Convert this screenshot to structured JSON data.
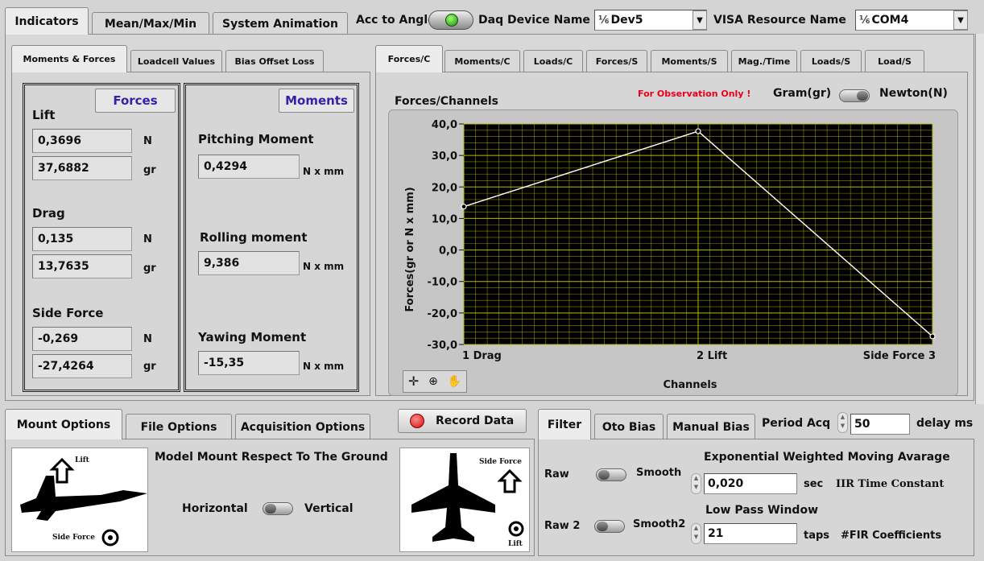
{
  "top_tabs": [
    "Indicators",
    "Mean/Max/Min",
    "System Animation"
  ],
  "header": {
    "acc_label": "Acc to Angle",
    "daq_label": "Daq Device Name",
    "daq_value": "Dev5",
    "visa_label": "VISA Resource Name",
    "visa_value": "COM4",
    "ring_glyph": "⅙"
  },
  "left_tabs": [
    "Moments & Forces",
    "Loadcell Values",
    "Bias Offset Loss"
  ],
  "forces": {
    "button": "Forces",
    "groups": [
      {
        "name": "Lift",
        "n_value": "0,3696",
        "gr_value": "37,6882"
      },
      {
        "name": "Drag",
        "n_value": "0,135",
        "gr_value": "13,7635"
      },
      {
        "name": "Side Force",
        "n_value": "-0,269",
        "gr_value": "-27,4264"
      }
    ],
    "unit_n": "N",
    "unit_gr": "gr"
  },
  "moments": {
    "button": "Moments",
    "items": [
      {
        "name": "Pitching Moment",
        "value": "0,4294"
      },
      {
        "name": "Rolling moment",
        "value": "9,386"
      },
      {
        "name": "Yawing Moment",
        "value": "-15,35"
      }
    ],
    "unit": "N x mm"
  },
  "chart_tabs": [
    "Forces/C",
    "Moments/C",
    "Loads/C",
    "Forces/S",
    "Moments/S",
    "Mag./Time",
    "Loads/S",
    "Load/S"
  ],
  "chart_header": {
    "observation": "For Observation Only !",
    "gram_label": "Gram(gr)",
    "newton_label": "Newton(N)"
  },
  "chart_data": {
    "type": "line",
    "title": "Forces/Channels",
    "xlabel": "Channels",
    "ylabel": "Forces(gr or N x mm)",
    "categories": [
      "1 Drag",
      "2 Lift",
      "Side Force 3"
    ],
    "values": [
      13.7635,
      37.6882,
      -27.4264
    ],
    "ylim": [
      -30,
      40
    ],
    "yticks": [
      "40,0",
      "30,0",
      "20,0",
      "10,0",
      "0,0",
      "-10,0",
      "-20,0",
      "-30,0"
    ],
    "grid": true,
    "colors": {
      "background": "#000000",
      "grid": "#b8b800",
      "line": "#ffffff"
    }
  },
  "bottom_tabs": [
    "Mount Options",
    "File Options",
    "Acquisition Options"
  ],
  "mount": {
    "title": "Model Mount Respect To The Ground",
    "horizontal": "Horizontal",
    "vertical": "Vertical",
    "lift_small": "Lift",
    "sideforce_small": "Side Force",
    "sideforce_r": "Side Force",
    "lift_r": "Lift"
  },
  "record_button": "Record Data",
  "filter_tabs": [
    "Filter",
    "Oto Bias",
    "Manual Bias"
  ],
  "filter": {
    "period_label": "Period Acq",
    "period_value": "50",
    "delay_unit": "delay ms",
    "raw": "Raw",
    "smooth": "Smooth",
    "raw2": "Raw 2",
    "smooth2": "Smooth2",
    "ewma_title": "Exponential Weighted Moving Avarage",
    "ewma_value": "0,020",
    "ewma_unit": "sec",
    "ewma_desc": "IIR Time Constant",
    "lpw_title": "Low Pass Window",
    "lpw_value": "21",
    "lpw_unit": "taps",
    "lpw_desc": "#FIR Coefficients"
  },
  "colors": {
    "accent_purple": "#3a1fa8",
    "observation_red": "#e8001c",
    "record_red": "#e41b1b"
  }
}
